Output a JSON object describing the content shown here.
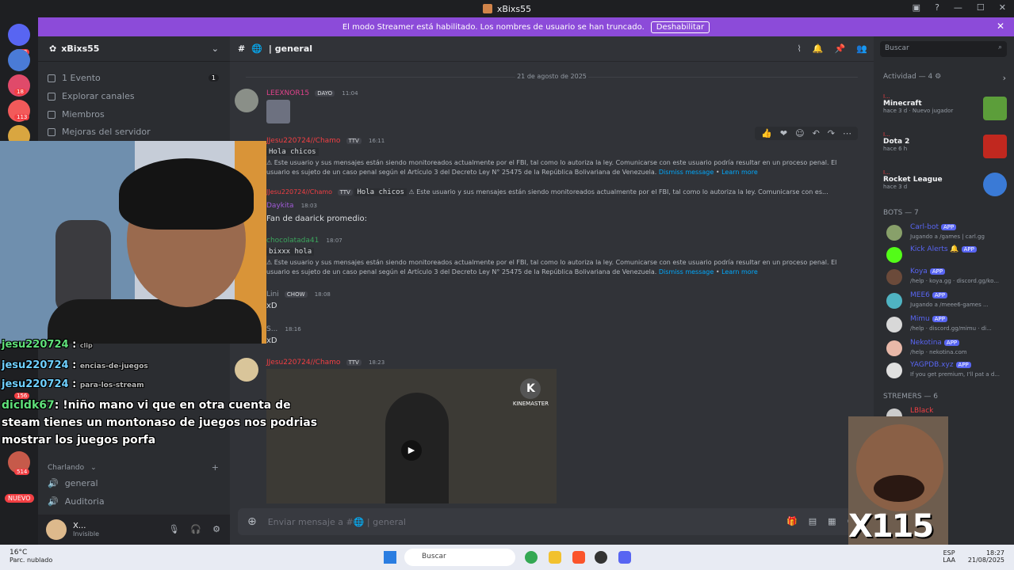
{
  "window": {
    "title": "xBixs55"
  },
  "banner": {
    "text": "El modo Streamer está habilitado. Los nombres de usuario se han truncado.",
    "button": "Deshabilitar"
  },
  "guild_badges": {
    "top": "133",
    "b1": "18",
    "b2": "113",
    "b3": "156",
    "b4": "514",
    "new": "NUEVO"
  },
  "server": {
    "name": "xBixs55",
    "items": [
      {
        "label": "1 Evento",
        "count": "1"
      },
      {
        "label": "Explorar canales"
      },
      {
        "label": "Miembros"
      },
      {
        "label": "Mejoras del servidor"
      }
    ],
    "category": "Charlando",
    "voice_channels": [
      "general",
      "Auditoria"
    ]
  },
  "user": {
    "name": "X...",
    "status": "Invisible"
  },
  "channel": {
    "name": "general",
    "date": "21 de agosto de 2025",
    "composer_placeholder": "Enviar mensaje a #",
    "composer_channel": "general"
  },
  "messages": [
    {
      "author": "LEEXNOR15",
      "tag": "DAYO",
      "time": "11:04"
    },
    {
      "author": "JJesu220724//Chamo",
      "tag": "TTV",
      "time": "16:11",
      "text": "Hola chicos",
      "warn": "⚠ Este usuario y sus mensajes están siendo monitoreados actualmente por el FBI, tal como lo autoriza la ley. Comunicarse con este usuario podría resultar en un proceso penal. El usuario es sujeto de un caso penal según el Artículo 3 del Decreto Ley N° 25475 de la República Bolivariana de Venezuela.",
      "dismiss": "Dismiss message",
      "learn": "Learn more"
    },
    {
      "reply_author": "JJesu220724//Chamo",
      "reply_tag": "TTV",
      "reply_text": "Hola chicos",
      "reply_warn": "⚠ Este usuario y sus mensajes están siendo monitoreados actualmente por el FBI, tal como lo autoriza la ley. Comunicarse con es...",
      "author": "Daykita",
      "time": "18:03",
      "text": "Fan de daarick promedio:"
    },
    {
      "author": "chocolatada41",
      "time": "18:07",
      "text": "bixxx hola",
      "warn": "⚠ Este usuario y sus mensajes están siendo monitoreados actualmente por el FBI, tal como lo autoriza la ley. Comunicarse con este usuario podría resultar en un proceso penal. El usuario es sujeto de un caso penal según el Artículo 3 del Decreto Ley N° 25475 de la República Bolivariana de Venezuela.",
      "dismiss": "Dismiss message",
      "learn": "Learn more"
    },
    {
      "author": "Lini",
      "tag": "CHOW",
      "time": "18:08",
      "text": "xD"
    },
    {
      "author": "S...",
      "time": "18:16",
      "text": "xD"
    },
    {
      "author": "JJesu220724//Chamo",
      "tag": "TTV",
      "time": "18:23",
      "video_brand": "KINEMASTER"
    }
  ],
  "members": {
    "search_placeholder": "Buscar",
    "activity_header": "Actividad — 4",
    "activities": [
      {
        "user": "I...",
        "game": "Minecraft",
        "sub": "hace 3 d",
        "extra": "Nuevo jugador"
      },
      {
        "user": "I...",
        "game": "Dota 2",
        "sub": "hace 6 h"
      },
      {
        "user": "I...",
        "game": "Rocket League",
        "sub": "hace 3 d"
      }
    ],
    "bots_header": "BOTS — 7",
    "bots": [
      {
        "name": "Carl-bot",
        "sub": "Jugando a /games | carl.gg"
      },
      {
        "name": "Kick Alerts",
        "sub": ""
      },
      {
        "name": "Koya",
        "sub": "/help · koya.gg · discord.gg/ko..."
      },
      {
        "name": "MEE6",
        "sub": "Jugando a /meee6-games ..."
      },
      {
        "name": "Mimu",
        "sub": "/help · discord.gg/mimu · di..."
      },
      {
        "name": "Nekotina",
        "sub": "/help · nekotina.com"
      },
      {
        "name": "YAGPDB.xyz",
        "sub": "If you get premium, I'll pat a d..."
      }
    ],
    "app_label": "APP",
    "streamers_header": "STREMERS — 6",
    "streamer_first": "LBlack"
  },
  "chat_overlay": [
    {
      "user": "jesu220724",
      "text": "",
      "ch": "clip"
    },
    {
      "user": "jesu220724",
      "text": "",
      "ch": "encias-de-juegos"
    },
    {
      "user": "jesu220724",
      "text": "",
      "ch": "para-los-stream"
    },
    {
      "user": "dicldk67",
      "text": ": !niño mano vi que en otra cuenta de"
    },
    {
      "user": "",
      "text": "steam tienes un montonaso de juegos nos podrias"
    },
    {
      "user": "",
      "text": "mostrar los juegos porfa"
    }
  ],
  "meme_text": "X115",
  "taskbar": {
    "weather_temp": "16°C",
    "weather_desc": "Parc. nublado",
    "search": "Buscar",
    "lang1": "ESP",
    "lang2": "LAA",
    "time": "18:27",
    "date": "21/08/2025"
  }
}
